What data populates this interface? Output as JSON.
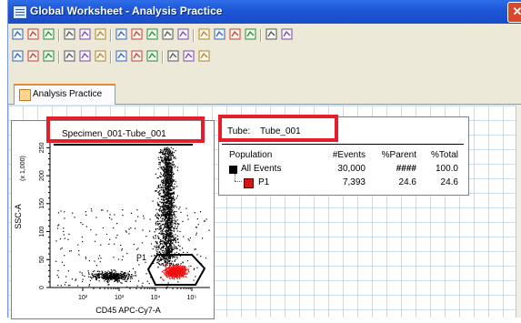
{
  "window": {
    "title": "Global Worksheet - Analysis Practice",
    "close_label": "✕"
  },
  "toolbars": {
    "row1": [
      "page-icon",
      "print-preview-icon",
      "print-icon",
      "pointer-icon",
      "dot-plot-icon",
      "histogram-icon",
      "zoom-in-icon",
      "zoom-out-icon",
      "layout-icon",
      "copy-plot-icon",
      "gate-polygon-icon",
      "gate-rect-icon",
      "gate-interval-icon",
      "grid-icon",
      "table-icon",
      "stats-icon",
      "export-icon"
    ],
    "row2": [
      "line-icon",
      "arrow-icon",
      "image-icon",
      "align-left-icon",
      "align-top-icon",
      "align-center-icon",
      "distribute-icon",
      "group-icon",
      "ungroup-icon",
      "snap-icon",
      "grid-toggle-icon",
      "magnet-icon"
    ]
  },
  "tab": {
    "label": "Analysis Practice"
  },
  "plot": {
    "title": "Specimen_001-Tube_001",
    "ylabel": "SSC-A",
    "xlabel": "CD45 APC-Cy7-A",
    "y_ticks": [
      "0",
      "50",
      "100",
      "150",
      "200",
      "250"
    ],
    "y_tick_suffix": "(x 1,000)",
    "x_ticks": [
      "10²",
      "10³",
      "10⁴",
      "10⁵"
    ],
    "gate_label": "P1",
    "colors": {
      "events": "#000000",
      "gate_events": "#ee1111",
      "gate_outline": "#000000"
    }
  },
  "stats": {
    "header_label": "Tube:",
    "tube_name": "Tube_001",
    "columns": [
      "Population",
      "#Events",
      "%Parent",
      "%Total"
    ],
    "rows": [
      {
        "name": "All Events",
        "events": "30,000",
        "parent": "####",
        "total": "100.0",
        "color": "#000000"
      },
      {
        "name": "P1",
        "events": "7,393",
        "parent": "24.6",
        "total": "24.6",
        "color": "#dd1111"
      }
    ]
  },
  "chart_data": {
    "type": "scatter",
    "xlabel": "CD45 APC-Cy7-A",
    "ylabel": "SSC-A",
    "x_scale": "log",
    "x_ticks": [
      "10²",
      "10³",
      "10⁴",
      "10⁵"
    ],
    "y_ticks": [
      0,
      50,
      100,
      150,
      200,
      250
    ],
    "y_unit": "(x 1,000)",
    "ylim": [
      0,
      262
    ],
    "series": [
      {
        "name": "All Events",
        "color": "#000000"
      },
      {
        "name": "P1",
        "color": "#ee1111"
      }
    ]
  }
}
